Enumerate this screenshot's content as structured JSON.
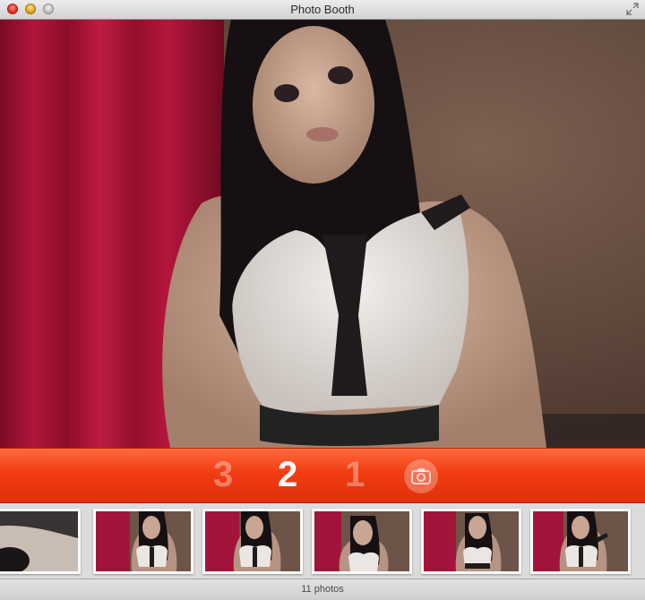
{
  "window": {
    "title": "Photo Booth"
  },
  "countdown": {
    "three": "3",
    "two": "2",
    "one": "1",
    "active": "2",
    "accent": "#f23c12"
  },
  "thumbnails": [
    {
      "name": "thumbnail-1"
    },
    {
      "name": "thumbnail-2"
    },
    {
      "name": "thumbnail-3"
    },
    {
      "name": "thumbnail-4"
    },
    {
      "name": "thumbnail-5"
    },
    {
      "name": "thumbnail-6"
    }
  ],
  "status": {
    "photo_count": "11 photos"
  },
  "icons": {
    "close": "close-button-icon",
    "minimize": "minimize-button-icon",
    "zoom": "zoom-button-icon",
    "fullscreen": "fullscreen-icon",
    "camera": "camera-icon"
  }
}
